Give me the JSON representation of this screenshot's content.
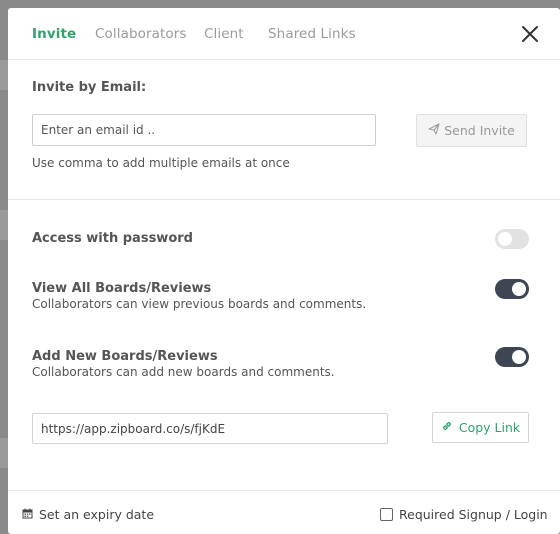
{
  "tabs": [
    {
      "label": "Invite",
      "active": true
    },
    {
      "label": "Collaborators",
      "active": false
    },
    {
      "label": "Client",
      "active": false
    },
    {
      "label": "Shared Links",
      "active": false
    }
  ],
  "invite": {
    "heading": "Invite by Email:",
    "email_placeholder": "Enter an email id ..",
    "send_label": "Send Invite",
    "hint": "Use comma to add multiple emails at once"
  },
  "settings": {
    "password": {
      "title": "Access with password",
      "enabled": false
    },
    "view_all": {
      "title": "View All Boards/Reviews",
      "desc": "Collaborators can view previous boards and comments.",
      "enabled": true
    },
    "add_new": {
      "title": "Add New Boards/Reviews",
      "desc": "Collaborators can add new boards and comments.",
      "enabled": true
    }
  },
  "share": {
    "link_value": "https://app.zipboard.co/s/fjKdE",
    "copy_label": "Copy Link"
  },
  "footer": {
    "expiry_label": "Set an expiry date",
    "signup_label": "Required Signup / Login",
    "signup_checked": false
  },
  "colors": {
    "accent": "#2fa36b",
    "toggle_on": "#3e4654",
    "toggle_off": "#e2e2e2"
  }
}
